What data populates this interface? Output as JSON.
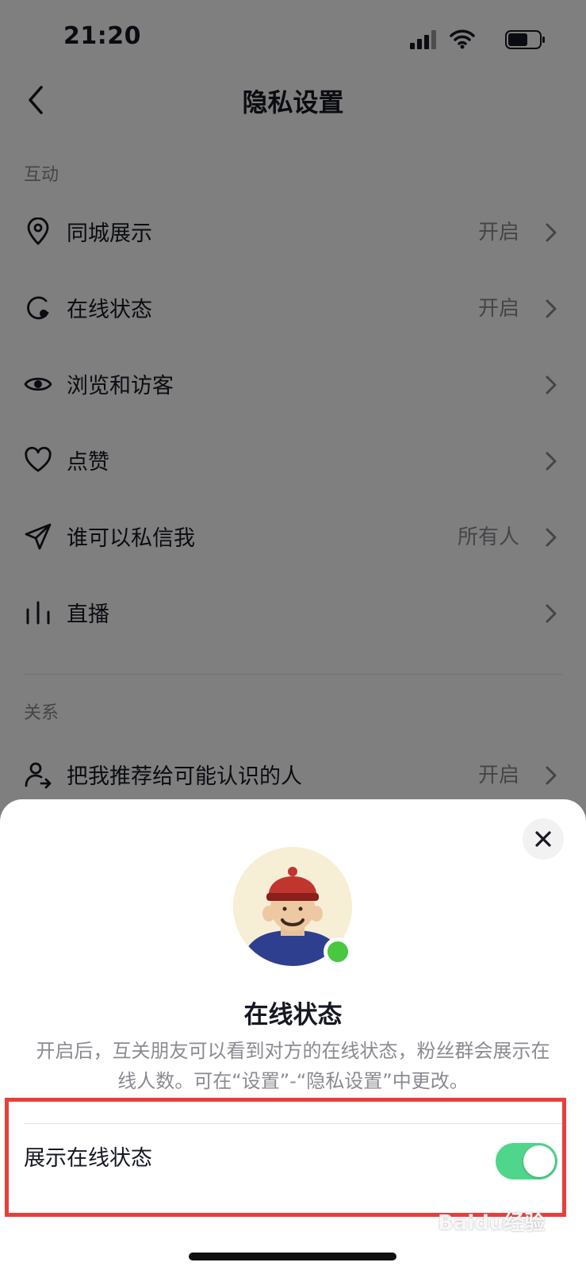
{
  "status_bar": {
    "time": "21:20"
  },
  "nav": {
    "title": "隐私设置"
  },
  "sections": [
    {
      "label": "互动",
      "items": [
        {
          "label": "同城展示",
          "value": "开启",
          "icon": "location-pin-icon"
        },
        {
          "label": "在线状态",
          "value": "开启",
          "icon": "online-status-icon"
        },
        {
          "label": "浏览和访客",
          "value": "",
          "icon": "eye-icon"
        },
        {
          "label": "点赞",
          "value": "",
          "icon": "heart-icon"
        },
        {
          "label": "谁可以私信我",
          "value": "所有人",
          "icon": "send-icon"
        },
        {
          "label": "直播",
          "value": "",
          "icon": "live-bars-icon"
        }
      ]
    },
    {
      "label": "关系",
      "items": [
        {
          "label": "把我推荐给可能认识的人",
          "value": "开启",
          "icon": "user-share-icon"
        }
      ]
    }
  ],
  "sheet": {
    "title": "在线状态",
    "description": "开启后，互关朋友可以看到对方的在线状态，粉丝群会展示在线人数。可在“设置”-“隐私设置”中更改。",
    "toggle_label": "展示在线状态",
    "toggle_on": true
  },
  "watermark": "Baidu经验",
  "colors": {
    "toggle_on": "#4fd68c",
    "online_dot": "#47c83e",
    "highlight": "#ea3e3a"
  }
}
